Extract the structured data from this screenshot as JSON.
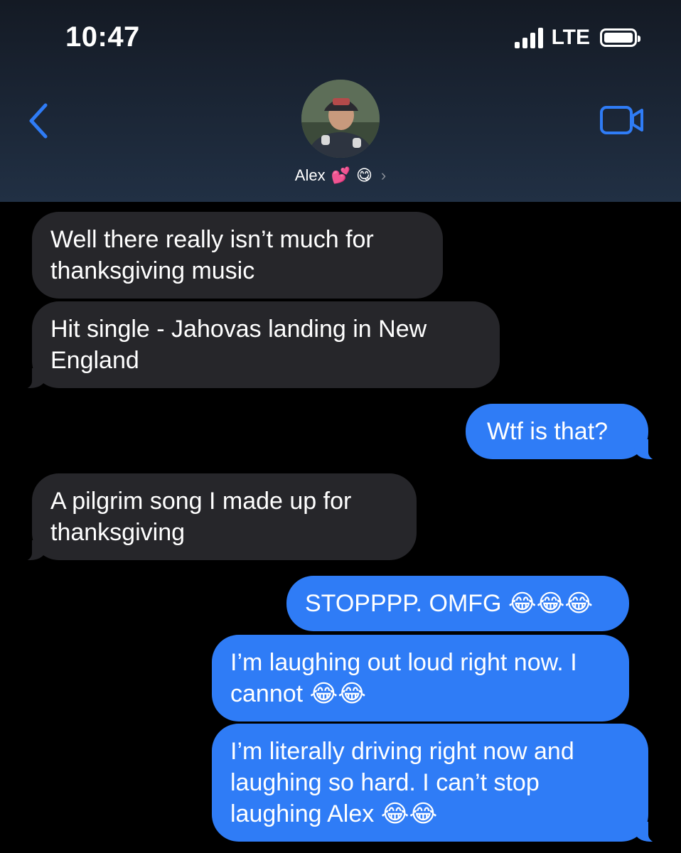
{
  "status_bar": {
    "time": "10:47",
    "network": "LTE",
    "signal_bars": 4,
    "battery_level": 1.0
  },
  "header": {
    "contact_name": "Alex",
    "contact_emojis": [
      "💕",
      "😋"
    ],
    "back_icon": "chevron-left-icon",
    "video_icon": "video-camera-icon",
    "accent_color": "#2f7cf6"
  },
  "messages": [
    {
      "sender": "them",
      "text": "Well there really isn’t much for thanksgiving music"
    },
    {
      "sender": "them",
      "text": "Hit single - Jahovas landing in New England"
    },
    {
      "sender": "me",
      "text": "Wtf is that?"
    },
    {
      "sender": "them",
      "text": "A pilgrim song I made up for thanksgiving"
    },
    {
      "sender": "me",
      "text": "STOPPPP. OMFG 😂😂😂"
    },
    {
      "sender": "me",
      "text": "I’m laughing out loud right now. I cannot 😂😂"
    },
    {
      "sender": "me",
      "text": "I’m literally driving right now and laughing so hard. I can’t stop laughing Alex 😂😂"
    }
  ],
  "colors": {
    "incoming_bubble": "#26262a",
    "outgoing_bubble": "#2f7cf6",
    "background": "#000000"
  }
}
